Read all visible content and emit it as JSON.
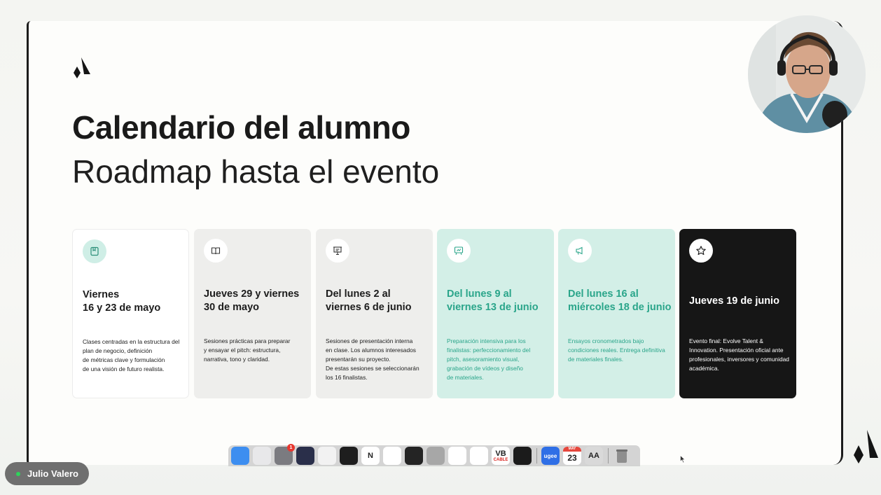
{
  "slide": {
    "title": "Calendario del alumno",
    "subtitle": "Roadmap hasta el evento",
    "cards": [
      {
        "icon": "bookmark-icon",
        "heading": [
          "Viernes",
          "16 y 23 de mayo"
        ],
        "body": [
          "Clases centradas en la estructura del",
          "plan de negocio, definición",
          "de métricas clave y formulación",
          "de una visión de futuro realista."
        ]
      },
      {
        "icon": "open-book-icon",
        "heading": [
          "Jueves 29 y viernes",
          "30 de mayo"
        ],
        "body": [
          "Sesiones prácticas para preparar",
          "y ensayar el pitch: estructura,",
          "narrativa, tono y claridad."
        ]
      },
      {
        "icon": "presentation-board-icon",
        "heading": [
          "Del lunes 2 al",
          "viernes 6 de junio"
        ],
        "body": [
          "Sesiones de presentación interna",
          "en clase. Los alumnos interesados",
          "presentarán su proyecto.",
          "De estas sesiones se seleccionarán",
          "los 16 finalistas."
        ]
      },
      {
        "icon": "screen-presentation-icon",
        "heading": [
          "Del lunes 9 al",
          "viernes 13 de junio"
        ],
        "body": [
          "Preparación intensiva para los",
          "finalistas: perfeccionamiento del",
          "pitch, asesoramiento visual,",
          "grabación de vídeos y diseño",
          "de materiales."
        ]
      },
      {
        "icon": "megaphone-icon",
        "heading": [
          "Del lunes 16 al",
          "miércoles 18 de junio"
        ],
        "body": [
          "Ensayos cronometrados bajo",
          "condiciones reales. Entrega definitiva",
          "de materiales finales."
        ]
      },
      {
        "icon": "star-icon",
        "heading": [
          "Jueves 19 de junio"
        ],
        "body": [
          "Evento final: Evolve Talent &",
          "Innovation. Presentación oficial ante",
          "profesionales, inversores y comunidad",
          "académica."
        ]
      }
    ]
  },
  "dock": {
    "apps": [
      {
        "name": "finder-icon",
        "label": "",
        "color": "#3d8ef0"
      },
      {
        "name": "launchpad-icon",
        "label": "",
        "color": "#e8e8ea"
      },
      {
        "name": "system-settings-icon",
        "label": "",
        "color": "#7b7b80",
        "badge": "1"
      },
      {
        "name": "obs-icon",
        "label": "",
        "color": "#2a2f4a"
      },
      {
        "name": "chatgpt-icon",
        "label": "",
        "color": "#f2f2f2"
      },
      {
        "name": "cursor-app-icon",
        "label": "",
        "color": "#1e1e1e"
      },
      {
        "name": "notion-icon",
        "label": "N",
        "color": "#ffffff"
      },
      {
        "name": "slack-icon",
        "label": "",
        "color": "#ffffff"
      },
      {
        "name": "terminal-icon",
        "label": "",
        "color": "#242424"
      },
      {
        "name": "database-icon",
        "label": "",
        "color": "#a7a7a7"
      },
      {
        "name": "chrome-icon",
        "label": "",
        "color": "#ffffff"
      },
      {
        "name": "vscode-icon",
        "label": "",
        "color": "#ffffff"
      },
      {
        "name": "vb-cable-icon",
        "label": "VB",
        "color": "#ffffff"
      },
      {
        "name": "audio-meter-icon",
        "label": "",
        "color": "#1b1b1b"
      }
    ],
    "apps_right": [
      {
        "name": "ugee-icon",
        "label": "ugee",
        "color": "#2f6fe6"
      },
      {
        "name": "calendar-icon",
        "label": "23",
        "color": "#ffffff"
      },
      {
        "name": "font-book-icon",
        "label": "AA",
        "color": "#d9d9d9"
      }
    ],
    "trash": {
      "name": "trash-icon"
    },
    "calendar_month": "MAY",
    "vb_sub": "CABLE"
  },
  "presenter": {
    "name": "Julio Valero",
    "status_color": "#2ed35a"
  },
  "colors": {
    "mint": "#d3efe7",
    "mint_text": "#2aa58a",
    "dark": "#161616",
    "gray": "#eeeeec"
  }
}
